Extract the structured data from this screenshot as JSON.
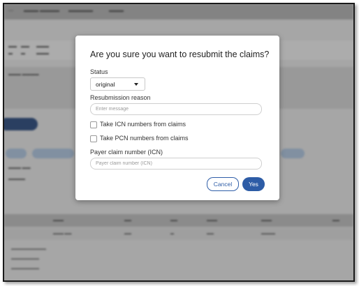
{
  "dialog": {
    "title": "Are you sure you want to resubmit the claims?",
    "status_label": "Status",
    "status_value": "original",
    "resubmission_reason_label": "Resubmission reason",
    "resubmission_reason_placeholder": "Enter message",
    "resubmission_reason_value": "",
    "checkbox_icn_label": "Take ICN numbers from claims",
    "checkbox_icn_checked": false,
    "checkbox_pcn_label": "Take PCN numbers from claims",
    "checkbox_pcn_checked": false,
    "payer_claim_label": "Payer claim number (ICN)",
    "payer_claim_placeholder": "Payer claim number (ICN)",
    "payer_claim_value": "",
    "cancel_label": "Cancel",
    "yes_label": "Yes"
  },
  "colors": {
    "primary": "#2d5ca6",
    "backdrop": "#cfcfcf"
  },
  "icons": {
    "status_dropdown": "caret-down-icon"
  }
}
